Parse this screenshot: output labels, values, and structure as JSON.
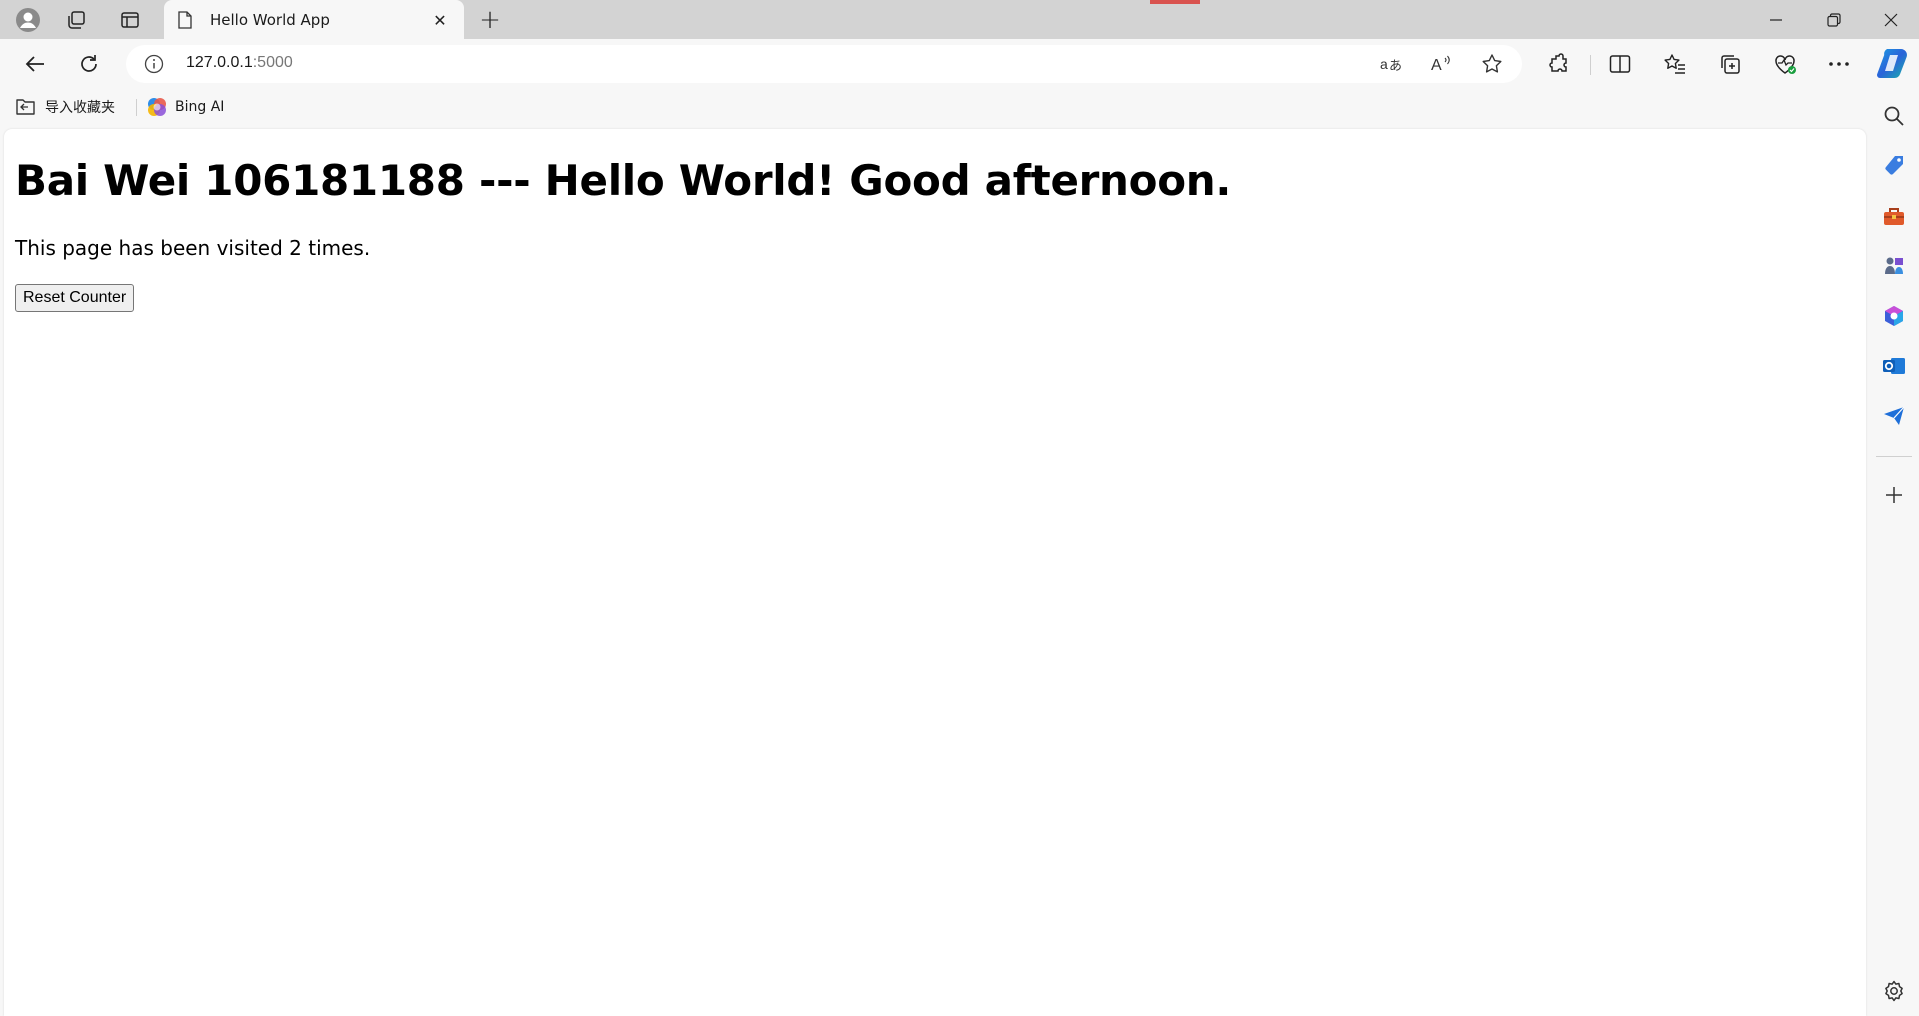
{
  "tab": {
    "title": "Hello World App"
  },
  "address_bar": {
    "host": "127.0.0.1",
    "port": ":5000"
  },
  "bookmarks": [
    {
      "label": "导入收藏夹",
      "icon": "import-favorites-icon"
    },
    {
      "label": "Bing AI",
      "icon": "bing-ai-icon"
    }
  ],
  "page": {
    "heading": "Bai Wei 106181188 --- Hello World! Good afternoon.",
    "visits_text": "This page has been visited 2 times.",
    "reset_button": "Reset Counter"
  },
  "colors": {
    "chrome_bg": "#f7f7f7",
    "tabstrip_bg": "#d3d3d3",
    "page_bg": "#ffffff",
    "accent_blue": "#1a73e8"
  }
}
